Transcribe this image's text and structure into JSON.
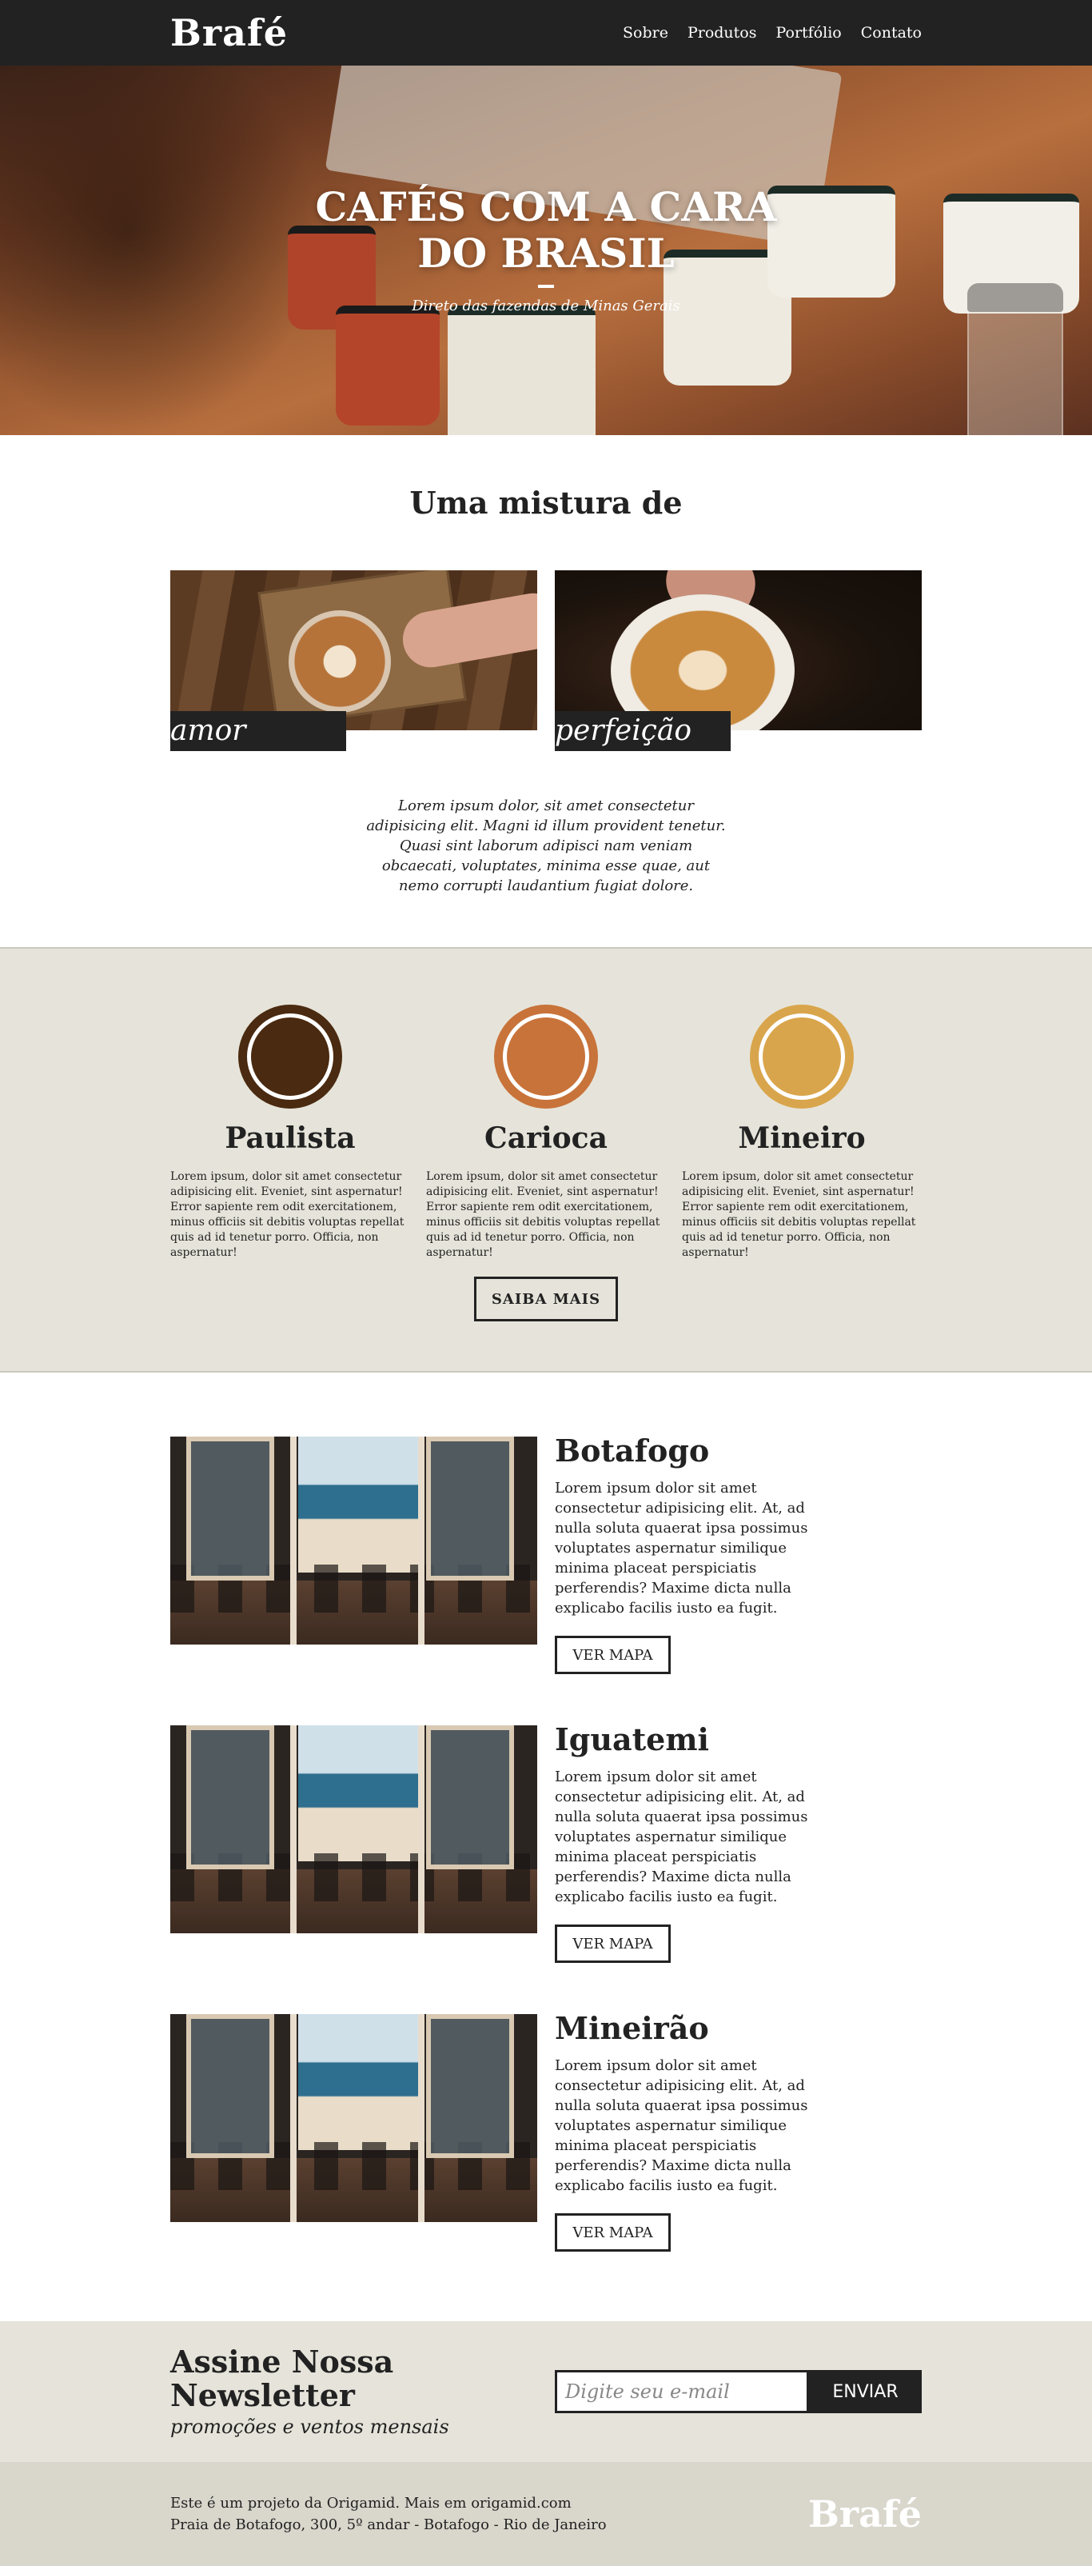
{
  "header": {
    "logo": "Brafé",
    "nav": [
      "Sobre",
      "Produtos",
      "Portfólio",
      "Contato"
    ]
  },
  "hero": {
    "title": "CAFÉS COM A CARA DO BRASIL",
    "subtitle": "Direto das fazendas de Minas Gerais"
  },
  "mix": {
    "title": "Uma mistura de",
    "items": [
      {
        "label": "amor"
      },
      {
        "label": "perfeição"
      }
    ],
    "text": "Lorem ipsum dolor, sit amet consectetur adipisicing elit. Magni id illum provident tenetur. Quasi sint laborum adipisci nam veniam obcaecati, voluptates, minima esse quae, aut nemo corrupti laudantium fugiat dolore."
  },
  "types": {
    "items": [
      {
        "name": "Paulista",
        "color": "#4a2a10",
        "text": "Lorem ipsum, dolor sit amet consectetur adipisicing elit. Eveniet, sint aspernatur! Error sapiente rem odit exercitationem, minus officiis sit debitis voluptas repellat quis ad id tenetur porro. Officia, non aspernatur!"
      },
      {
        "name": "Carioca",
        "color": "#c8733a",
        "text": "Lorem ipsum, dolor sit amet consectetur adipisicing elit. Eveniet, sint aspernatur! Error sapiente rem odit exercitationem, minus officiis sit debitis voluptas repellat quis ad id tenetur porro. Officia, non aspernatur!"
      },
      {
        "name": "Mineiro",
        "color": "#d9a54c",
        "text": "Lorem ipsum, dolor sit amet consectetur adipisicing elit. Eveniet, sint aspernatur! Error sapiente rem odit exercitationem, minus officiis sit debitis voluptas repellat quis ad id tenetur porro. Officia, non aspernatur!"
      }
    ],
    "button": "SAIBA MAIS"
  },
  "locations": [
    {
      "name": "Botafogo",
      "text": "Lorem ipsum dolor sit amet consectetur adipisicing elit. At, ad nulla soluta quaerat ipsa possimus voluptates aspernatur similique minima placeat perspiciatis perferendis? Maxime dicta nulla explicabo facilis iusto ea fugit.",
      "button": "VER MAPA"
    },
    {
      "name": "Iguatemi",
      "text": "Lorem ipsum dolor sit amet consectetur adipisicing elit. At, ad nulla soluta quaerat ipsa possimus voluptates aspernatur similique minima placeat perspiciatis perferendis? Maxime dicta nulla explicabo facilis iusto ea fugit.",
      "button": "VER MAPA"
    },
    {
      "name": "Mineirão",
      "text": "Lorem ipsum dolor sit amet consectetur adipisicing elit. At, ad nulla soluta quaerat ipsa possimus voluptates aspernatur similique minima placeat perspiciatis perferendis? Maxime dicta nulla explicabo facilis iusto ea fugit.",
      "button": "VER MAPA"
    }
  ],
  "newsletter": {
    "title": "Assine Nossa Newsletter",
    "subtitle": "promoções e ventos mensais",
    "placeholder": "Digite seu e-mail",
    "button": "ENVIAR"
  },
  "footer": {
    "line1": "Este é um projeto da Origamid. Mais em origamid.com",
    "line2": "Praia de Botafogo, 300, 5º andar - Botafogo - Rio de Janeiro",
    "logo": "Brafé"
  }
}
